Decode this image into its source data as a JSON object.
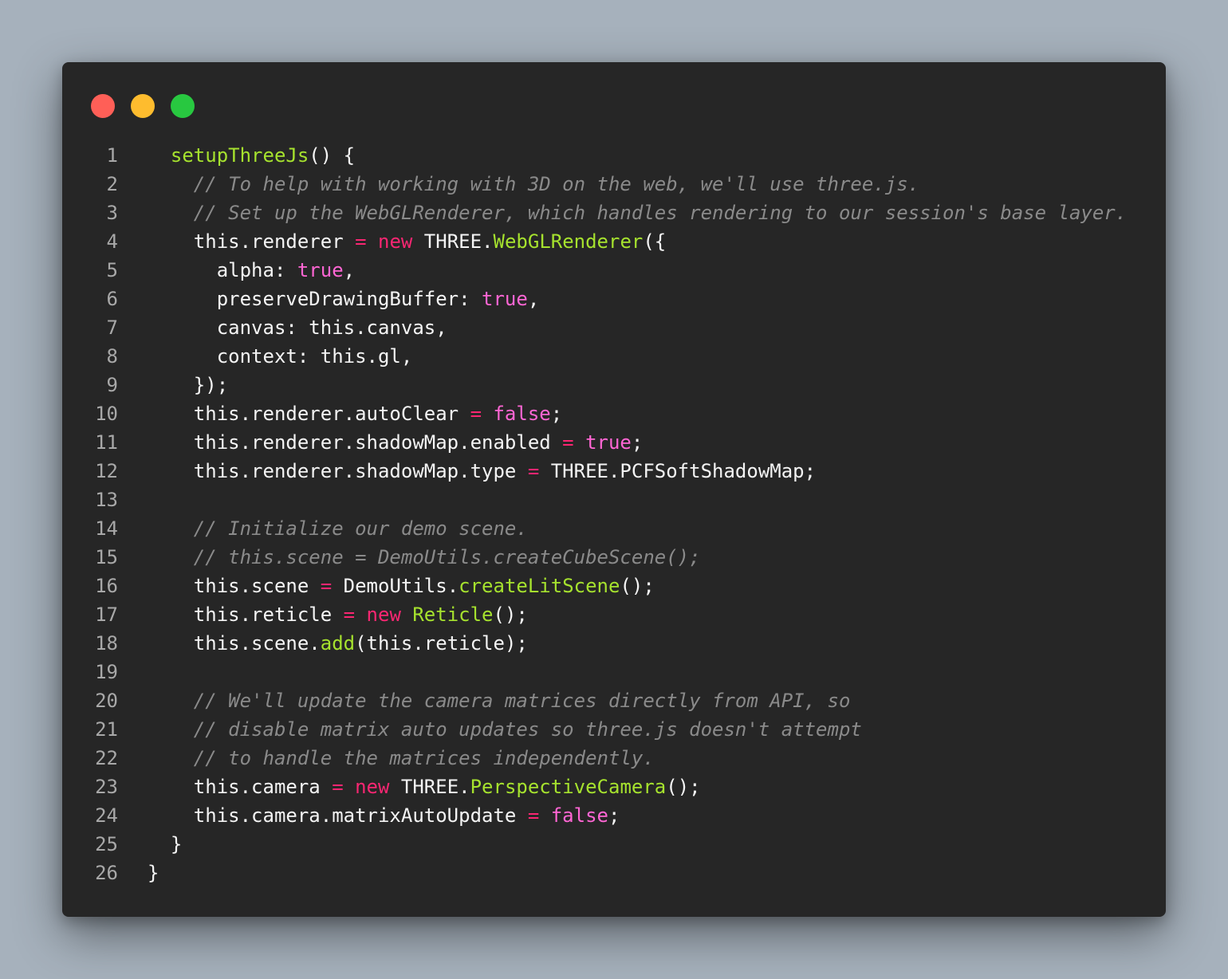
{
  "theme": {
    "page_background": "#a6b1bc",
    "window_background": "#262626",
    "line_number_color": "#a8a8a8",
    "plain_color": "#f4f4f4",
    "function_color": "#a6e22e",
    "keyword_color": "#f92672",
    "boolean_color": "#ff66d4",
    "comment_color": "#8a8a8a"
  },
  "window_controls": [
    {
      "name": "close",
      "color": "#ff5f57"
    },
    {
      "name": "minimize",
      "color": "#febc2e"
    },
    {
      "name": "maximize",
      "color": "#28c840"
    }
  ],
  "code_lines": [
    {
      "number": "1",
      "tokens": [
        {
          "t": "  ",
          "c": "plain"
        },
        {
          "t": "setupThreeJs",
          "c": "fn"
        },
        {
          "t": "() {",
          "c": "plain"
        }
      ]
    },
    {
      "number": "2",
      "tokens": [
        {
          "t": "    ",
          "c": "plain"
        },
        {
          "t": "// To help with working with 3D on the web, we'll use three.js.",
          "c": "comment"
        }
      ]
    },
    {
      "number": "3",
      "tokens": [
        {
          "t": "    ",
          "c": "plain"
        },
        {
          "t": "// Set up the WebGLRenderer, which handles rendering to our session's base layer.",
          "c": "comment"
        }
      ]
    },
    {
      "number": "4",
      "tokens": [
        {
          "t": "    this.renderer ",
          "c": "plain"
        },
        {
          "t": "=",
          "c": "op"
        },
        {
          "t": " ",
          "c": "plain"
        },
        {
          "t": "new",
          "c": "kw"
        },
        {
          "t": " THREE.",
          "c": "plain"
        },
        {
          "t": "WebGLRenderer",
          "c": "fn"
        },
        {
          "t": "({",
          "c": "plain"
        }
      ]
    },
    {
      "number": "5",
      "tokens": [
        {
          "t": "      alpha: ",
          "c": "plain"
        },
        {
          "t": "true",
          "c": "bool"
        },
        {
          "t": ",",
          "c": "plain"
        }
      ]
    },
    {
      "number": "6",
      "tokens": [
        {
          "t": "      preserveDrawingBuffer: ",
          "c": "plain"
        },
        {
          "t": "true",
          "c": "bool"
        },
        {
          "t": ",",
          "c": "plain"
        }
      ]
    },
    {
      "number": "7",
      "tokens": [
        {
          "t": "      canvas: this.canvas,",
          "c": "plain"
        }
      ]
    },
    {
      "number": "8",
      "tokens": [
        {
          "t": "      context: this.gl,",
          "c": "plain"
        }
      ]
    },
    {
      "number": "9",
      "tokens": [
        {
          "t": "    });",
          "c": "plain"
        }
      ]
    },
    {
      "number": "10",
      "tokens": [
        {
          "t": "    this.renderer.autoClear ",
          "c": "plain"
        },
        {
          "t": "=",
          "c": "op"
        },
        {
          "t": " ",
          "c": "plain"
        },
        {
          "t": "false",
          "c": "bool"
        },
        {
          "t": ";",
          "c": "plain"
        }
      ]
    },
    {
      "number": "11",
      "tokens": [
        {
          "t": "    this.renderer.shadowMap.enabled ",
          "c": "plain"
        },
        {
          "t": "=",
          "c": "op"
        },
        {
          "t": " ",
          "c": "plain"
        },
        {
          "t": "true",
          "c": "bool"
        },
        {
          "t": ";",
          "c": "plain"
        }
      ]
    },
    {
      "number": "12",
      "tokens": [
        {
          "t": "    this.renderer.shadowMap.type ",
          "c": "plain"
        },
        {
          "t": "=",
          "c": "op"
        },
        {
          "t": " THREE.PCFSoftShadowMap;",
          "c": "plain"
        }
      ]
    },
    {
      "number": "13",
      "tokens": []
    },
    {
      "number": "14",
      "tokens": [
        {
          "t": "    ",
          "c": "plain"
        },
        {
          "t": "// Initialize our demo scene.",
          "c": "comment"
        }
      ]
    },
    {
      "number": "15",
      "tokens": [
        {
          "t": "    ",
          "c": "plain"
        },
        {
          "t": "// this.scene = DemoUtils.createCubeScene();",
          "c": "comment"
        }
      ]
    },
    {
      "number": "16",
      "tokens": [
        {
          "t": "    this.scene ",
          "c": "plain"
        },
        {
          "t": "=",
          "c": "op"
        },
        {
          "t": " DemoUtils.",
          "c": "plain"
        },
        {
          "t": "createLitScene",
          "c": "fn"
        },
        {
          "t": "();",
          "c": "plain"
        }
      ]
    },
    {
      "number": "17",
      "tokens": [
        {
          "t": "    this.reticle ",
          "c": "plain"
        },
        {
          "t": "=",
          "c": "op"
        },
        {
          "t": " ",
          "c": "plain"
        },
        {
          "t": "new",
          "c": "kw"
        },
        {
          "t": " ",
          "c": "plain"
        },
        {
          "t": "Reticle",
          "c": "fn"
        },
        {
          "t": "();",
          "c": "plain"
        }
      ]
    },
    {
      "number": "18",
      "tokens": [
        {
          "t": "    this.scene.",
          "c": "plain"
        },
        {
          "t": "add",
          "c": "fn"
        },
        {
          "t": "(this.reticle);",
          "c": "plain"
        }
      ]
    },
    {
      "number": "19",
      "tokens": []
    },
    {
      "number": "20",
      "tokens": [
        {
          "t": "    ",
          "c": "plain"
        },
        {
          "t": "// We'll update the camera matrices directly from API, so",
          "c": "comment"
        }
      ]
    },
    {
      "number": "21",
      "tokens": [
        {
          "t": "    ",
          "c": "plain"
        },
        {
          "t": "// disable matrix auto updates so three.js doesn't attempt",
          "c": "comment"
        }
      ]
    },
    {
      "number": "22",
      "tokens": [
        {
          "t": "    ",
          "c": "plain"
        },
        {
          "t": "// to handle the matrices independently.",
          "c": "comment"
        }
      ]
    },
    {
      "number": "23",
      "tokens": [
        {
          "t": "    this.camera ",
          "c": "plain"
        },
        {
          "t": "=",
          "c": "op"
        },
        {
          "t": " ",
          "c": "plain"
        },
        {
          "t": "new",
          "c": "kw"
        },
        {
          "t": " THREE.",
          "c": "plain"
        },
        {
          "t": "PerspectiveCamera",
          "c": "fn"
        },
        {
          "t": "();",
          "c": "plain"
        }
      ]
    },
    {
      "number": "24",
      "tokens": [
        {
          "t": "    this.camera.matrixAutoUpdate ",
          "c": "plain"
        },
        {
          "t": "=",
          "c": "op"
        },
        {
          "t": " ",
          "c": "plain"
        },
        {
          "t": "false",
          "c": "bool"
        },
        {
          "t": ";",
          "c": "plain"
        }
      ]
    },
    {
      "number": "25",
      "tokens": [
        {
          "t": "  }",
          "c": "plain"
        }
      ]
    },
    {
      "number": "26",
      "tokens": [
        {
          "t": "}",
          "c": "plain"
        }
      ]
    }
  ]
}
